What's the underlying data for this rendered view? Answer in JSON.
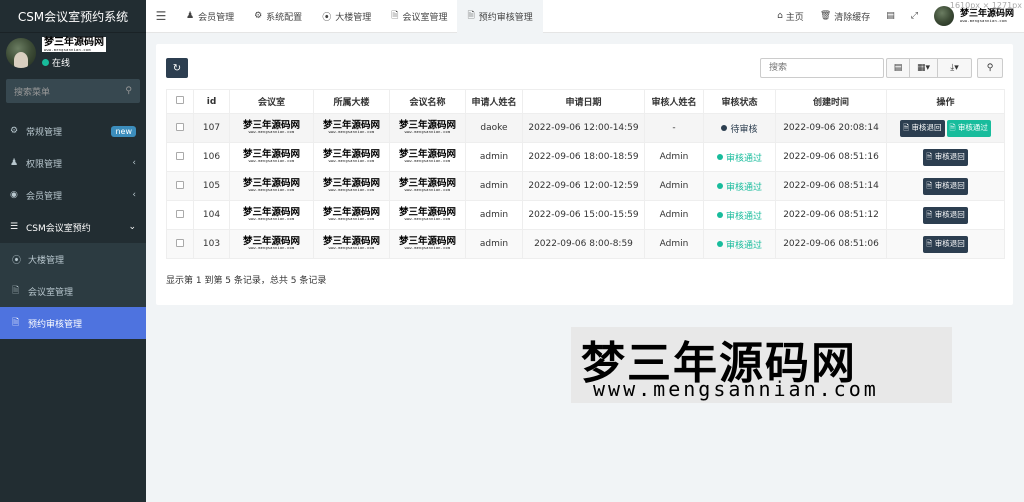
{
  "app": {
    "title": "CSM会议室预约系统",
    "logo_text": "梦三年源码网",
    "logo_sub": "www.mengsannian.com",
    "status": "在线"
  },
  "sidebar": {
    "search_placeholder": "搜索菜单",
    "items": [
      {
        "label": "常规管理",
        "icon": "gear-icon",
        "badge": "new"
      },
      {
        "label": "权限管理",
        "icon": "group-icon"
      },
      {
        "label": "会员管理",
        "icon": "user-circle-icon"
      },
      {
        "label": "CSM会议室预约",
        "icon": "list-icon"
      }
    ],
    "subitems": [
      {
        "label": "大楼管理",
        "icon": "circle-dot-icon"
      },
      {
        "label": "会议室管理",
        "icon": "file-icon"
      },
      {
        "label": "预约审核管理",
        "icon": "file-icon"
      }
    ]
  },
  "topbar": {
    "tabs": [
      {
        "label": "会员管理",
        "icon": "user-icon"
      },
      {
        "label": "系统配置",
        "icon": "gear-icon"
      },
      {
        "label": "大楼管理",
        "icon": "circle-dot-icon"
      },
      {
        "label": "会议室管理",
        "icon": "file-icon"
      },
      {
        "label": "预约审核管理",
        "icon": "file-icon"
      }
    ],
    "home": "主页",
    "clear_cache": "清除缓存",
    "dim_label": "1610px × 1271px"
  },
  "toolbar": {
    "search_placeholder": "搜索"
  },
  "table": {
    "headers": [
      "id",
      "会议室",
      "所属大楼",
      "会议名称",
      "申请人姓名",
      "申请日期",
      "审核人姓名",
      "审核状态",
      "创建时间",
      "操作"
    ],
    "rows": [
      {
        "id": "107",
        "applicant": "daoke",
        "date": "2022-09-06 12:00-14:59",
        "reviewer": "-",
        "status": "待审核",
        "status_type": "pending",
        "created": "2022-09-06 20:08:14",
        "ops": [
          "审核退回",
          "审核通过"
        ]
      },
      {
        "id": "106",
        "applicant": "admin",
        "date": "2022-09-06 18:00-18:59",
        "reviewer": "Admin",
        "status": "审核通过",
        "status_type": "passed",
        "created": "2022-09-06 08:51:16",
        "ops": [
          "审核退回"
        ]
      },
      {
        "id": "105",
        "applicant": "admin",
        "date": "2022-09-06 12:00-12:59",
        "reviewer": "Admin",
        "status": "审核通过",
        "status_type": "passed",
        "created": "2022-09-06 08:51:14",
        "ops": [
          "审核退回"
        ]
      },
      {
        "id": "104",
        "applicant": "admin",
        "date": "2022-09-06 15:00-15:59",
        "reviewer": "Admin",
        "status": "审核通过",
        "status_type": "passed",
        "created": "2022-09-06 08:51:12",
        "ops": [
          "审核退回"
        ]
      },
      {
        "id": "103",
        "applicant": "admin",
        "date": "2022-09-06 8:00-8:59",
        "reviewer": "Admin",
        "status": "审核通过",
        "status_type": "passed",
        "created": "2022-09-06 08:51:06",
        "ops": [
          "审核退回"
        ]
      }
    ]
  },
  "footer": {
    "info": "显示第 1 到第 5 条记录，总共 5 条记录"
  },
  "watermark": {
    "line1": "梦三年源码网",
    "line2": "www.mengsannian.com"
  },
  "colors": {
    "sidebar_bg": "#222d32",
    "active": "#4e73df",
    "primary": "#2c3e50",
    "success": "#18bc9c"
  }
}
